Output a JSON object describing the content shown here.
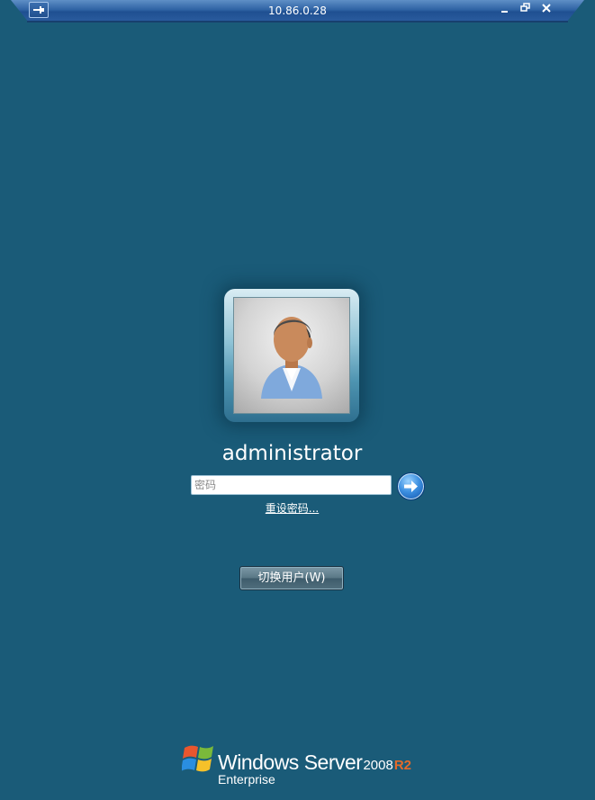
{
  "connection_bar": {
    "title": "10.86.0.28",
    "pin_icon": "pin-icon",
    "controls": {
      "minimize_icon": "minimize-icon",
      "restore_icon": "restore-icon",
      "close_icon": "close-icon"
    }
  },
  "login": {
    "avatar_icon": "user-avatar-icon",
    "username": "administrator",
    "password_placeholder": "密码",
    "submit_icon": "arrow-right-icon",
    "reset_password_link": "重设密码...",
    "switch_user_button": "切换用户(W)"
  },
  "branding": {
    "logo_icon": "windows-flag-icon",
    "product_name": "Windows Server",
    "version_year": "2008",
    "version_release": "R2",
    "edition": "Enterprise"
  },
  "colors": {
    "background": "#1a5b78",
    "connection_bar": "#2f63a4",
    "r2_accent": "#e46a2a",
    "text": "#ffffff"
  }
}
